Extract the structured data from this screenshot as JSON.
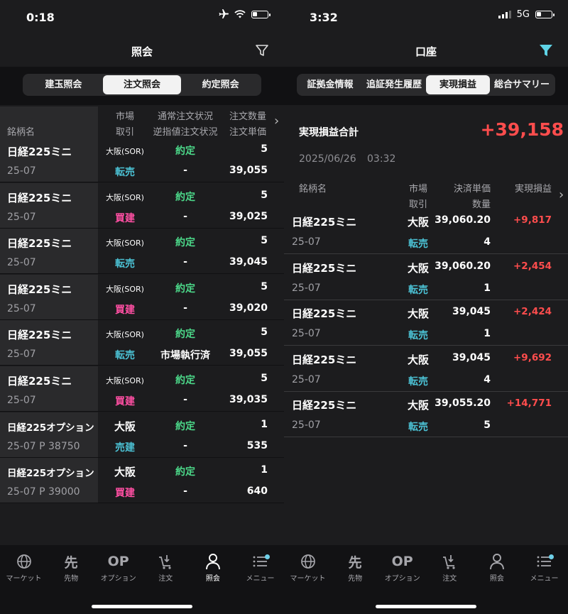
{
  "left": {
    "status": {
      "time": "0:18"
    },
    "nav": {
      "title": "照会"
    },
    "segments": [
      "建玉照会",
      "注文照会",
      "約定照会"
    ],
    "headers": {
      "name": "銘柄名",
      "market": "市場",
      "trade": "取引",
      "status1": "通常注文状況",
      "status2": "逆指値注文状況",
      "qty": "注文数量",
      "price": "注文単価"
    },
    "rows": [
      {
        "name": "日経225ミニ",
        "contract": "25-07",
        "market": "大阪(SOR)",
        "trade": "転売",
        "trade_color": "teal",
        "status": "約定",
        "stop": "-",
        "qty": "5",
        "price": "39,055"
      },
      {
        "name": "日経225ミニ",
        "contract": "25-07",
        "market": "大阪(SOR)",
        "trade": "買建",
        "trade_color": "pink",
        "status": "約定",
        "stop": "-",
        "qty": "5",
        "price": "39,025"
      },
      {
        "name": "日経225ミニ",
        "contract": "25-07",
        "market": "大阪(SOR)",
        "trade": "転売",
        "trade_color": "teal",
        "status": "約定",
        "stop": "-",
        "qty": "5",
        "price": "39,045"
      },
      {
        "name": "日経225ミニ",
        "contract": "25-07",
        "market": "大阪(SOR)",
        "trade": "買建",
        "trade_color": "pink",
        "status": "約定",
        "stop": "-",
        "qty": "5",
        "price": "39,020"
      },
      {
        "name": "日経225ミニ",
        "contract": "25-07",
        "market": "大阪(SOR)",
        "trade": "転売",
        "trade_color": "teal",
        "status": "約定",
        "stop": "市場執行済",
        "qty": "5",
        "price": "39,055"
      },
      {
        "name": "日経225ミニ",
        "contract": "25-07",
        "market": "大阪(SOR)",
        "trade": "買建",
        "trade_color": "pink",
        "status": "約定",
        "stop": "-",
        "qty": "5",
        "price": "39,035"
      },
      {
        "name": "日経225オプション",
        "contract": "25-07 P 38750",
        "market": "大阪",
        "trade": "売建",
        "trade_color": "teal",
        "status": "約定",
        "stop": "-",
        "qty": "1",
        "price": "535"
      },
      {
        "name": "日経225オプション",
        "contract": "25-07 P 39000",
        "market": "大阪",
        "trade": "買建",
        "trade_color": "pink",
        "status": "約定",
        "stop": "-",
        "qty": "1",
        "price": "640"
      }
    ]
  },
  "right": {
    "status": {
      "time": "3:32",
      "network": "5G"
    },
    "nav": {
      "title": "口座"
    },
    "segments": [
      "証拠金情報",
      "追証発生履歴",
      "実現損益",
      "総合サマリー"
    ],
    "summary": {
      "label": "実現損益合計",
      "value": "+39,158",
      "date": "2025/06/26",
      "time": "03:32"
    },
    "headers": {
      "name": "銘柄名",
      "market": "市場",
      "trade": "取引",
      "price": "決済単価",
      "qty": "数量",
      "pl": "実現損益"
    },
    "rows": [
      {
        "name": "日経225ミニ",
        "contract": "25-07",
        "market": "大阪",
        "trade": "転売",
        "price": "39,060.20",
        "qty": "4",
        "pl": "+9,817"
      },
      {
        "name": "日経225ミニ",
        "contract": "25-07",
        "market": "大阪",
        "trade": "転売",
        "price": "39,060.20",
        "qty": "1",
        "pl": "+2,454"
      },
      {
        "name": "日経225ミニ",
        "contract": "25-07",
        "market": "大阪",
        "trade": "転売",
        "price": "39,045",
        "qty": "1",
        "pl": "+2,424"
      },
      {
        "name": "日経225ミニ",
        "contract": "25-07",
        "market": "大阪",
        "trade": "転売",
        "price": "39,045",
        "qty": "4",
        "pl": "+9,692"
      },
      {
        "name": "日経225ミニ",
        "contract": "25-07",
        "market": "大阪",
        "trade": "転売",
        "price": "39,055.20",
        "qty": "5",
        "pl": "+14,771"
      }
    ]
  },
  "tabs": [
    {
      "label": "マーケット",
      "icon": "globe-icon"
    },
    {
      "label": "先物",
      "icon": "futures-icon",
      "glyph": "先"
    },
    {
      "label": "オプション",
      "icon": "options-icon",
      "glyph": "OP"
    },
    {
      "label": "注文",
      "icon": "order-cart-icon"
    },
    {
      "label": "照会",
      "icon": "person-icon"
    },
    {
      "label": "メニュー",
      "icon": "menu-icon"
    }
  ],
  "active_tab_left": "照会",
  "colors": {
    "green": "#4cd98a",
    "teal": "#4bc0d3",
    "pink": "#ff4fa3",
    "red": "#ff4d4d",
    "filter_active": "#5fd3e6"
  }
}
